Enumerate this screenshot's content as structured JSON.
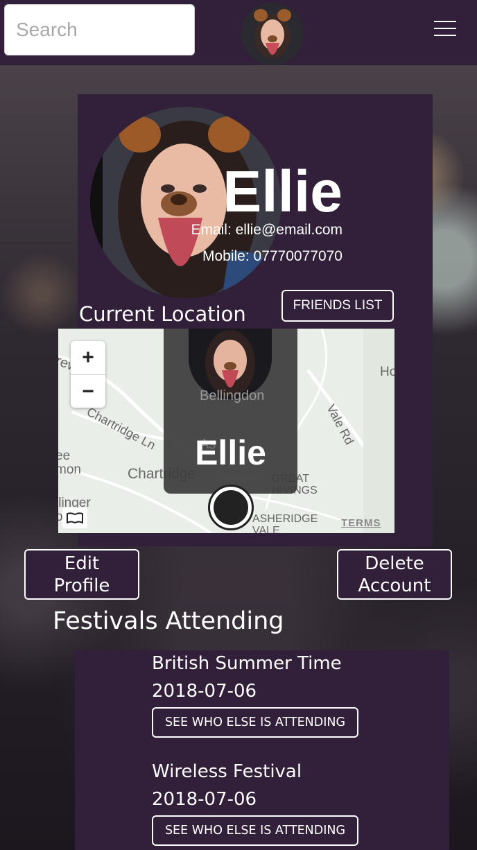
{
  "header": {
    "search_placeholder": "Search",
    "avatar_icon": "profile-photo-dog-filter",
    "menu_icon": "hamburger-icon"
  },
  "profile": {
    "name": "Ellie",
    "email": "Email: ellie@email.com",
    "mobile": "Mobile: 07770077070",
    "friends_button": "FRIENDS LIST",
    "current_location_label": "Current Location"
  },
  "map": {
    "zoom_in": "+",
    "zoom_out": "−",
    "popup_name": "Ellie",
    "terms": "TERMS",
    "labels": {
      "bellingdon": "Bellingdon",
      "chartridge_ln": "Chartridge Ln",
      "chartridge": "Chartridge",
      "vale_rd": "Vale Rd",
      "great_hivings": "GREAT\nHIVINGS",
      "asheridge_vale": "ASHERIDGE\nVALE",
      "ee_mon": "ee\nmon",
      "llinger": "llinger\non",
      "ho": "Ho",
      "rew": "rew",
      "as": "As"
    }
  },
  "actions": {
    "edit_profile": "Edit\nProfile",
    "delete_account": "Delete\nAccount"
  },
  "festivals": {
    "heading": "Festivals Attending",
    "items": [
      {
        "name": "British Summer Time",
        "date": "2018-07-06",
        "button": "SEE WHO ELSE IS ATTENDING"
      },
      {
        "name": "Wireless Festival",
        "date": "2018-07-06",
        "button": "SEE WHO ELSE IS ATTENDING"
      }
    ]
  },
  "colors": {
    "panel": "#32203a",
    "map_bg": "#eaeee9",
    "text": "#ffffff"
  }
}
